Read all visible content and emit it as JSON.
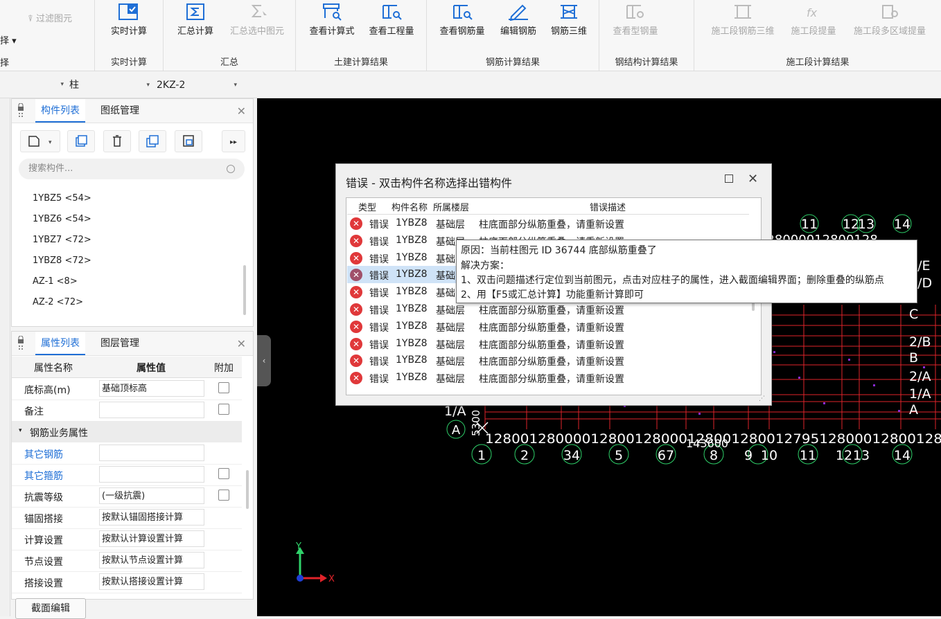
{
  "ribbon": {
    "left_items": {
      "filter_label": "过滤图元",
      "select_label": "择"
    },
    "groups": [
      {
        "title": "实时计算",
        "buttons": [
          {
            "label": "实时计算",
            "disabled": false
          }
        ]
      },
      {
        "title": "汇总",
        "buttons": [
          {
            "label": "汇总计算",
            "disabled": false
          },
          {
            "label": "汇总选中图元",
            "disabled": true
          }
        ]
      },
      {
        "title": "土建计算结果",
        "buttons": [
          {
            "label": "查看计算式",
            "disabled": false
          },
          {
            "label": "查看工程量",
            "disabled": false
          }
        ]
      },
      {
        "title": "钢筋计算结果",
        "buttons": [
          {
            "label": "查看钢筋量",
            "disabled": false
          },
          {
            "label": "编辑钢筋",
            "disabled": false
          },
          {
            "label": "钢筋三维",
            "disabled": false
          }
        ]
      },
      {
        "title": "钢结构计算结果",
        "buttons": [
          {
            "label": "查看型钢量",
            "disabled": true
          }
        ]
      },
      {
        "title": "施工段计算结果",
        "buttons": [
          {
            "label": "施工段钢筋三维",
            "disabled": true
          },
          {
            "label": "施工段提量",
            "disabled": true
          },
          {
            "label": "施工段多区域提量",
            "disabled": true
          }
        ]
      }
    ]
  },
  "selectors": {
    "type": "柱",
    "name": "2KZ-2"
  },
  "component_panel": {
    "tabs": [
      "构件列表",
      "图纸管理"
    ],
    "search_placeholder": "搜索构件...",
    "items": [
      "1YBZ5 <54>",
      "1YBZ6 <54>",
      "1YBZ7 <72>",
      "1YBZ8 <72>",
      "AZ-1 <8>",
      "AZ-2 <72>"
    ]
  },
  "property_panel": {
    "tabs": [
      "属性列表",
      "图层管理"
    ],
    "headers": [
      "属性名称",
      "属性值",
      "附加"
    ],
    "rows": [
      {
        "name": "底标高(m)",
        "value": "基础顶标高",
        "check": true,
        "link": false
      },
      {
        "name": "备注",
        "value": "",
        "check": true,
        "link": false
      },
      {
        "name": "钢筋业务属性",
        "group": true
      },
      {
        "name": "其它钢筋",
        "value": "",
        "check": false,
        "link": true
      },
      {
        "name": "其它箍筋",
        "value": "",
        "check": true,
        "link": true
      },
      {
        "name": "抗震等级",
        "value": "(一级抗震)",
        "check": true,
        "link": false
      },
      {
        "name": "锚固搭接",
        "value": "按默认锚固搭接计算",
        "check": false,
        "link": false
      },
      {
        "name": "计算设置",
        "value": "按默认计算设置计算",
        "check": false,
        "link": false
      },
      {
        "name": "节点设置",
        "value": "按默认节点设置计算",
        "check": false,
        "link": false
      },
      {
        "name": "搭接设置",
        "value": "按默认搭接设置计算",
        "check": false,
        "link": false
      }
    ],
    "section_edit_button": "截面编辑"
  },
  "dialog": {
    "title": "错误 - 双击构件名称选择出错构件",
    "headers": [
      "类型",
      "构件名称",
      "所属楼层",
      "错误描述"
    ],
    "rows": [
      {
        "type": "错误",
        "name": "1YBZ8",
        "floor": "基础层",
        "desc": "柱底面部分纵筋重叠，请重新设置"
      },
      {
        "type": "错误",
        "name": "1YBZ8",
        "floor": "基础层",
        "desc": "柱底面部分纵筋重叠，请重新设置"
      },
      {
        "type": "错误",
        "name": "1YBZ8",
        "floor": "基础",
        "desc": ""
      },
      {
        "type": "错误",
        "name": "1YBZ8",
        "floor": "基础",
        "desc": ""
      },
      {
        "type": "错误",
        "name": "1YBZ8",
        "floor": "基础",
        "desc": ""
      },
      {
        "type": "错误",
        "name": "1YBZ8",
        "floor": "基础层",
        "desc": "柱底面部分纵筋重叠，请重新设置"
      },
      {
        "type": "错误",
        "name": "1YBZ8",
        "floor": "基础层",
        "desc": "柱底面部分纵筋重叠，请重新设置"
      },
      {
        "type": "错误",
        "name": "1YBZ8",
        "floor": "基础层",
        "desc": "柱底面部分纵筋重叠，请重新设置"
      },
      {
        "type": "错误",
        "name": "1YBZ8",
        "floor": "基础层",
        "desc": "柱底面部分纵筋重叠，请重新设置"
      },
      {
        "type": "错误",
        "name": "1YBZ8",
        "floor": "基础层",
        "desc": "柱底面部分纵筋重叠，请重新设置"
      }
    ]
  },
  "tooltip": {
    "line1": "原因：当前柱图元 ID 36744 底部纵筋重叠了",
    "line2": "解决方案：",
    "line3": "1、双击问题描述行定位到当前图元，点击对应柱子的属性，进入截面编辑界面；删除重叠的纵筋点",
    "line4": "2、用【F5或汇总计算】功能重新计算即可"
  },
  "canvas": {
    "axis_numbers_top": [
      "11",
      "12",
      "13",
      "14"
    ],
    "axis_numbers_bottom": [
      "1",
      "2",
      "34",
      "5",
      "67",
      "8",
      "9",
      "10",
      "11",
      "12",
      "13",
      "14"
    ],
    "dims_bottom": "1280012800001280012800012800128001279512800012800128",
    "dim_total": "143600",
    "row_labels": [
      "1/E",
      "1/D",
      "C",
      "2/B",
      "B",
      "2/A",
      "1/A",
      "A"
    ],
    "left_labels": [
      "1/A",
      "A"
    ],
    "vertical_dim": "5300",
    "coord_x": "X",
    "coord_y": "Y",
    "colors": {
      "bg": "#000000",
      "grid": "#e0232a",
      "axis_green": "#2fd16a",
      "white": "#ffffff",
      "purple": "#8a2ad6"
    }
  }
}
